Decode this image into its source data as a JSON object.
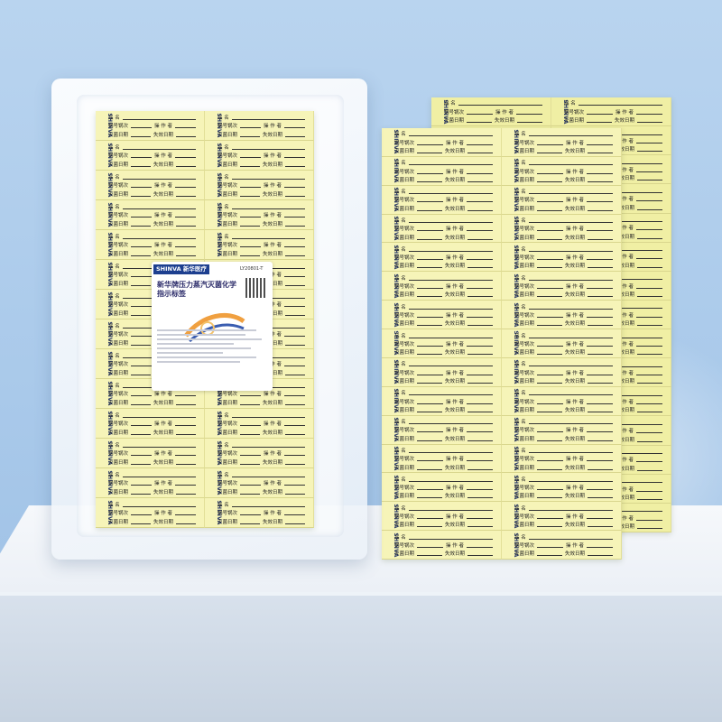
{
  "product": {
    "brand": "SHINVA",
    "brand_cn": "新华医疗",
    "model": "LY20801-T",
    "title": "新华牌压力蒸汽灭菌化学指示标签"
  },
  "label_fields": {
    "name": "品 名",
    "pot_batch": "锅号锅次",
    "operator": "操 作 者",
    "sterilize_date": "灭菌日期",
    "expiry_date": "失效日期"
  }
}
